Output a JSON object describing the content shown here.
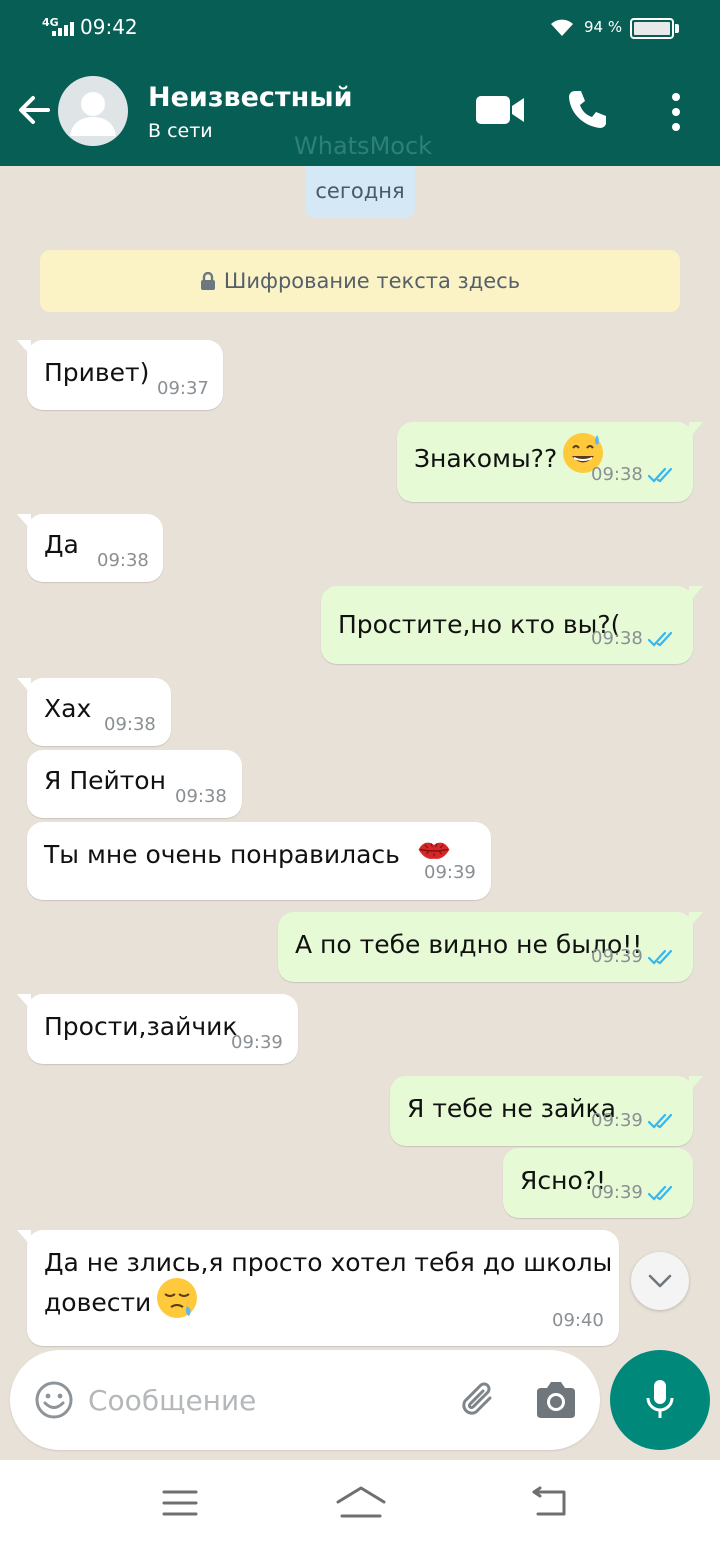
{
  "status_bar": {
    "network": "4G",
    "time": "09:42",
    "battery": "94 %"
  },
  "header": {
    "name": "Неизвестный",
    "status": "В сети",
    "watermark": "WhatsMock"
  },
  "chat": {
    "date_chip": "сегодня",
    "encryption_note": "Шифрование текста здесь",
    "messages": [
      {
        "dir": "in",
        "text": "Привет)",
        "time": "09:37"
      },
      {
        "dir": "out",
        "text": "Знакомы??",
        "emoji": "grinning-sweat",
        "time": "09:38",
        "read": true
      },
      {
        "dir": "in",
        "text": "Да",
        "time": "09:38"
      },
      {
        "dir": "out",
        "text": "Простите,но кто вы?(",
        "time": "09:38",
        "read": true
      },
      {
        "dir": "in",
        "text": "Хах",
        "time": "09:38"
      },
      {
        "dir": "in",
        "text": "Я Пейтон",
        "time": "09:38"
      },
      {
        "dir": "in",
        "text": "Ты мне очень понравилась",
        "emoji": "kiss-mark",
        "time": "09:39"
      },
      {
        "dir": "out",
        "text": "А по тебе видно не было!!",
        "time": "09:39",
        "read": true
      },
      {
        "dir": "in",
        "text": "Прости,зайчик",
        "time": "09:39"
      },
      {
        "dir": "out",
        "text": "Я тебе не зайка",
        "time": "09:39",
        "read": true
      },
      {
        "dir": "out",
        "text": "Ясно?!",
        "time": "09:39",
        "read": true
      },
      {
        "dir": "in",
        "text": "Да не злись,я просто хотел тебя до школы",
        "text2": "довести",
        "emoji": "sleepy-face",
        "time": "09:40"
      }
    ]
  },
  "input": {
    "placeholder": "Сообщение"
  },
  "colors": {
    "header": "#075e54",
    "accent": "#00897b",
    "outgoing": "#e6fbd5",
    "incoming": "#ffffff",
    "read_ticks": "#34b7f1"
  }
}
